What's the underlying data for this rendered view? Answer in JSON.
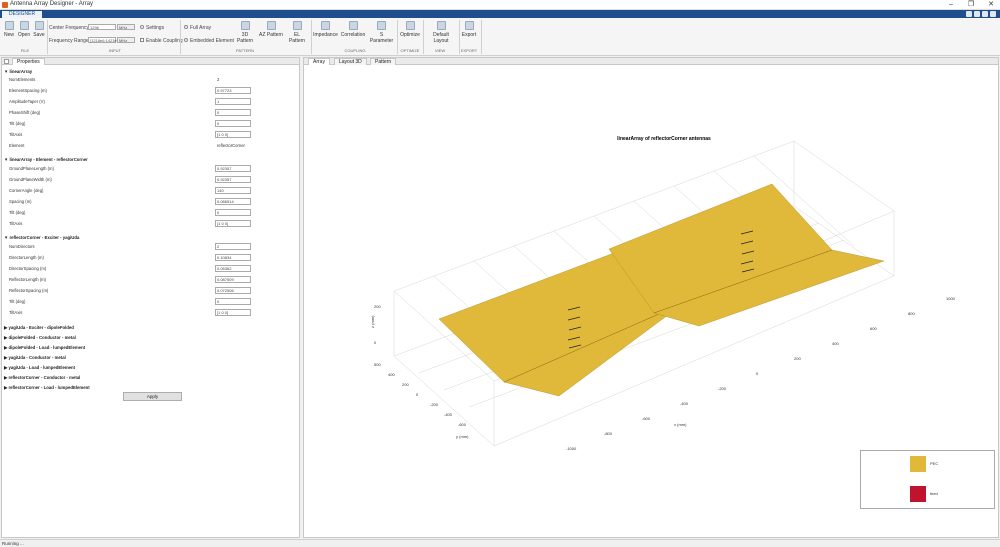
{
  "window": {
    "title": "Antenna Array Designer - Array",
    "min": "–",
    "max": "❐",
    "close": "✕"
  },
  "ribbon_tab": "DESIGNER",
  "ribbon": {
    "file": {
      "new": "New",
      "open": "Open",
      "save": "Save",
      "group": "FILE"
    },
    "input": {
      "center_frequency_label": "Center Frequency",
      "center_frequency_value": "1296",
      "center_frequency_unit": "MHz",
      "frequency_range_label": "Frequency Range",
      "frequency_range_value": "[1218e6:1423e6]",
      "frequency_range_unit": "MHz",
      "settings": "Settings",
      "enable_coupling": "Enable Coupling",
      "group": "INPUT"
    },
    "pattern": {
      "full_array": "Full Array",
      "embedded_element": "Embedded Element",
      "pattern3d": "3D Pattern",
      "az_pattern": "AZ Pattern",
      "el_pattern": "EL Pattern",
      "group": "PATTERN"
    },
    "coupling": {
      "impedance": "Impedance",
      "correlation": "Correlation",
      "sparam": "S Parameter",
      "group": "COUPLING"
    },
    "optimize": {
      "optimize": "Optimize",
      "group": "OPTIMIZE"
    },
    "view": {
      "default_layout": "Default Layout",
      "group": "VIEW"
    },
    "export": {
      "export": "Export",
      "group": "EXPORT"
    }
  },
  "left_tab": "Properties",
  "sections": [
    {
      "title": "linearArray",
      "rows": [
        {
          "label": "NumElements",
          "value": "2",
          "kind": "text"
        },
        {
          "label": "ElementSpacing (m)",
          "value": "0.97723",
          "kind": "input"
        },
        {
          "label": "AmplitudeTaper (V)",
          "value": "1",
          "kind": "input"
        },
        {
          "label": "PhaseShift (deg)",
          "value": "0",
          "kind": "input"
        },
        {
          "label": "Tilt (deg)",
          "value": "0",
          "kind": "input"
        },
        {
          "label": "TiltAxis",
          "value": "[1 0 0]",
          "kind": "input"
        },
        {
          "label": "Element",
          "value": "reflectorCorner",
          "kind": "text"
        }
      ]
    },
    {
      "title": "linearArray - Element - reflectorCorner",
      "rows": [
        {
          "label": "GroundPlaneLength (m)",
          "value": "0.92357",
          "kind": "input"
        },
        {
          "label": "GroundPlaneWidth (m)",
          "value": "0.92357",
          "kind": "input"
        },
        {
          "label": "CornerAngle (deg)",
          "value": "140",
          "kind": "input"
        },
        {
          "label": "Spacing (m)",
          "value": "0.086514",
          "kind": "input"
        },
        {
          "label": "Tilt (deg)",
          "value": "0",
          "kind": "input"
        },
        {
          "label": "TiltAxis",
          "value": "[1 0 0]",
          "kind": "input"
        }
      ]
    },
    {
      "title": "reflectorCorner - Exciter - yagiUda",
      "rows": [
        {
          "label": "NumDirectors",
          "value": "2",
          "kind": "input"
        },
        {
          "label": "DirectorLength (m)",
          "value": "0.10834",
          "kind": "input"
        },
        {
          "label": "DirectorSpacing (m)",
          "value": "0.05362",
          "kind": "input"
        },
        {
          "label": "ReflectorLength (m)",
          "value": "0.087509",
          "kind": "input"
        },
        {
          "label": "ReflectorSpacing (m)",
          "value": "0.072506",
          "kind": "input"
        },
        {
          "label": "Tilt (deg)",
          "value": "0",
          "kind": "input"
        },
        {
          "label": "TiltAxis",
          "value": "[1 0 0]",
          "kind": "input"
        }
      ]
    }
  ],
  "collapsed_sections": [
    "yagiUda - Exciter - dipoleFolded",
    "dipoleFolded - Conductor - metal",
    "dipoleFolded - Load - lumpedElement",
    "yagiUda - Conductor - metal",
    "yagiUda - Load - lumpedElement",
    "reflectorCorner - Conductor - metal",
    "reflectorCorner - Load - lumpedElement"
  ],
  "apply": "Apply",
  "right_tabs": [
    "Array",
    "Layout 3D",
    "Pattern"
  ],
  "plot": {
    "title": "linearArray of reflectorCorner antennas",
    "xlabel": "x (mm)",
    "ylabel": "y (mm)",
    "zlabel": "z (mm)",
    "x_ticks": [
      "-1000",
      "-800",
      "-600",
      "-400",
      "-200",
      "0",
      "200",
      "400",
      "600",
      "800",
      "1000"
    ],
    "y_ticks": [
      "-600",
      "-400",
      "-200",
      "0",
      "200",
      "400",
      "500"
    ],
    "z_ticks": [
      "0",
      "200"
    ]
  },
  "legend": [
    {
      "label": "PEC",
      "color": "#e0b93a"
    },
    {
      "label": "feed",
      "color": "#c0142c"
    }
  ],
  "status": "Running ..."
}
